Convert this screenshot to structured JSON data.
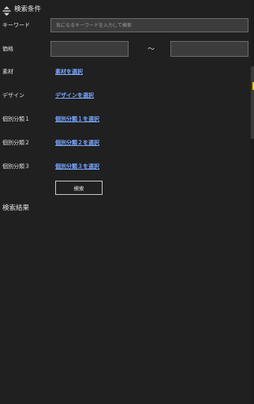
{
  "header": {
    "title": "検索条件",
    "icon": "collapse-icon"
  },
  "keyword": {
    "label": "キーワード",
    "value": "",
    "placeholder": "気になるキーワードを入力して検索"
  },
  "price": {
    "label": "価格",
    "min_value": "",
    "max_value": "",
    "separator": "～"
  },
  "material": {
    "label": "素材",
    "link": "素材を選択"
  },
  "design": {
    "label": "デザイン",
    "link": "デザインを選択"
  },
  "category1": {
    "label": "個別分類１",
    "link": "個別分類１を選択"
  },
  "category2": {
    "label": "個別分類２",
    "link": "個別分類２を選択"
  },
  "category3": {
    "label": "個別分類３",
    "link": "個別分類３を選択"
  },
  "search_button": {
    "label": "検索"
  },
  "results": {
    "title": "検索結果"
  },
  "colors": {
    "background": "#202020",
    "input_background": "#3c3c3c",
    "link": "#7aa7ff",
    "scroll_accent": "#e8d000"
  }
}
